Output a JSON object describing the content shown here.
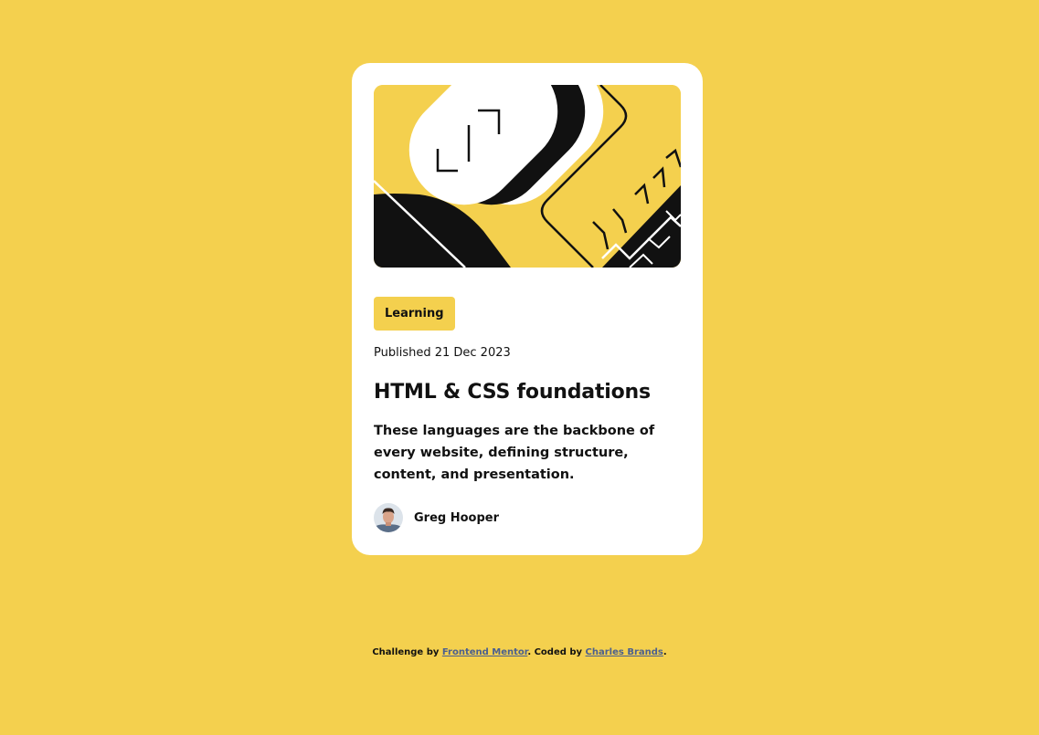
{
  "colors": {
    "background": "#F4D04E",
    "card": "#FFFFFF",
    "text": "#111111",
    "link": "#4A5F8F"
  },
  "card": {
    "hero_image": "illustration-article",
    "tag": "Learning",
    "published": "Published 21 Dec 2023",
    "title": "HTML & CSS foundations",
    "description": "These languages are the backbone of every website, defining structure, content, and presentation.",
    "author": {
      "avatar": "avatar-image",
      "name": "Greg Hooper"
    }
  },
  "footer": {
    "challenge_prefix": "Challenge by",
    "challenge_link": "Frontend Mentor",
    "coded_prefix": ". Coded by",
    "coded_link": "Charles Brands",
    "suffix": "."
  }
}
